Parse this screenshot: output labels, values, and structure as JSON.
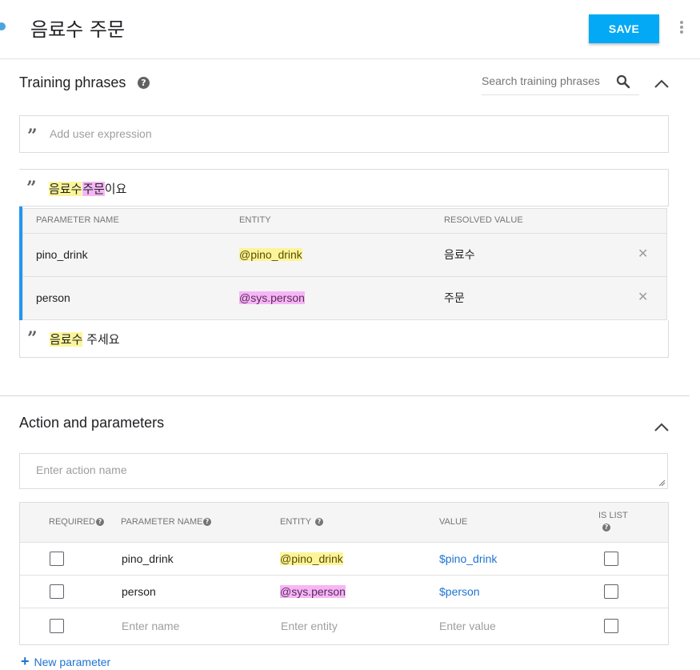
{
  "header": {
    "title": "음료수 주문",
    "save_label": "SAVE"
  },
  "training": {
    "title": "Training phrases",
    "search_placeholder": "Search training phrases",
    "add_placeholder": "Add user expression",
    "phrase1": {
      "part1": "음료수",
      "part2": "주문",
      "part3": "이요"
    },
    "param_headers": {
      "name": "PARAMETER NAME",
      "entity": "ENTITY",
      "resolved": "RESOLVED VALUE"
    },
    "params": [
      {
        "name": "pino_drink",
        "entity": "@pino_drink",
        "resolved": "음료수"
      },
      {
        "name": "person",
        "entity": "@sys.person",
        "resolved": "주문"
      }
    ],
    "phrase2": {
      "part1": "음료수",
      "part2": " 주세요"
    }
  },
  "action": {
    "title": "Action and parameters",
    "action_placeholder": "Enter action name",
    "headers": {
      "required": "REQUIRED",
      "name": "PARAMETER NAME",
      "entity": "ENTITY",
      "value": "VALUE",
      "is_list": "IS LIST"
    },
    "rows": [
      {
        "name": "pino_drink",
        "entity": "@pino_drink",
        "value": "$pino_drink",
        "required": false,
        "is_list": false
      },
      {
        "name": "person",
        "entity": "@sys.person",
        "value": "$person",
        "required": false,
        "is_list": false
      }
    ],
    "empty_row": {
      "name": "Enter name",
      "entity": "Enter entity",
      "value": "Enter value"
    },
    "new_parameter": "New parameter"
  },
  "colors": {
    "accent": "#03a9f4",
    "link": "#1e73d2",
    "entity_yellow": "#fbf59a",
    "entity_pink": "#f6b6f6",
    "selected_bar": "#2196f3"
  },
  "icons": [
    "more-vert-icon",
    "help-icon",
    "search-icon",
    "chevron-up-icon",
    "quote-icon",
    "close-icon",
    "plus-icon"
  ]
}
